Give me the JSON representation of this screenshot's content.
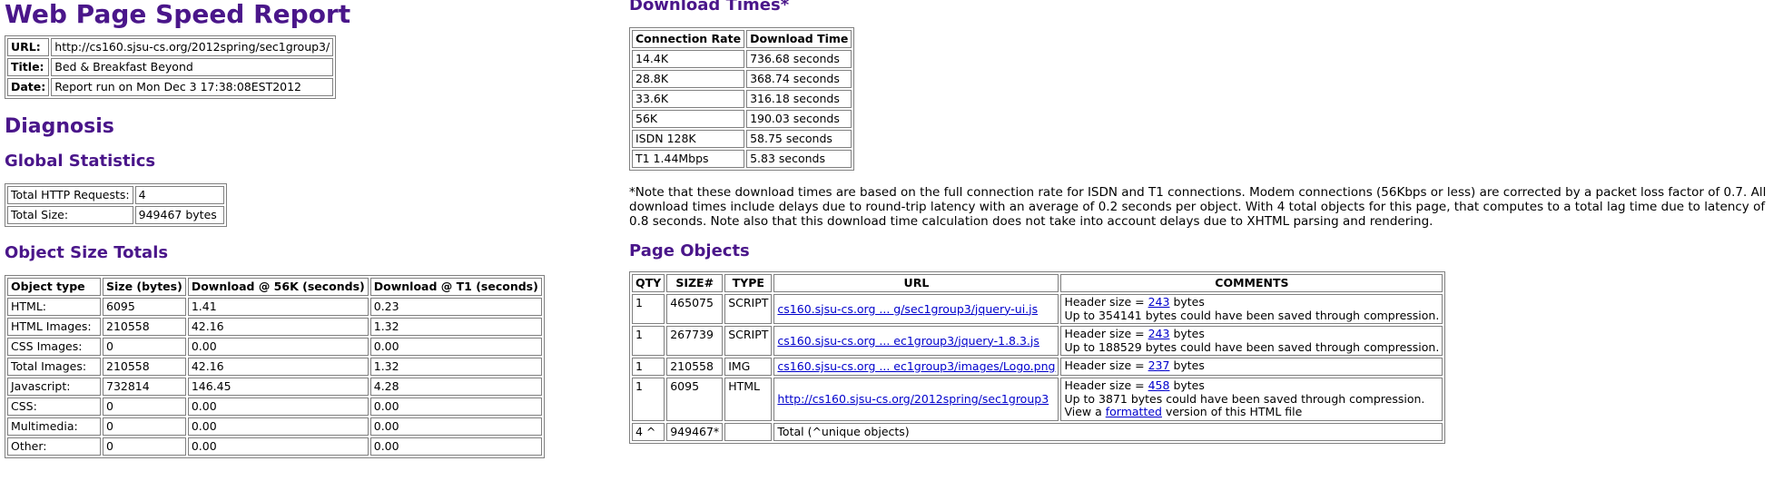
{
  "title": "Web Page Speed Report",
  "info": [
    {
      "label": "URL:",
      "value": "http://cs160.sjsu-cs.org/2012spring/sec1group3/"
    },
    {
      "label": "Title:",
      "value": "Bed & Breakfast Beyond"
    },
    {
      "label": "Date:",
      "value": "Report run on Mon Dec 3 17:38:08EST2012"
    }
  ],
  "diagnosis_heading": "Diagnosis",
  "global": {
    "heading": "Global Statistics",
    "rows": [
      {
        "label": "Total HTTP Requests:",
        "value": "4"
      },
      {
        "label": "Total Size:",
        "value": "949467 bytes"
      }
    ]
  },
  "totals": {
    "heading": "Object Size Totals",
    "headers": [
      "Object type",
      "Size (bytes)",
      "Download @ 56K (seconds)",
      "Download @ T1 (seconds)"
    ],
    "rows": [
      [
        "HTML:",
        "6095",
        "1.41",
        "0.23"
      ],
      [
        "HTML Images:",
        "210558",
        "42.16",
        "1.32"
      ],
      [
        "CSS Images:",
        "0",
        "0.00",
        "0.00"
      ],
      [
        "Total Images:",
        "210558",
        "42.16",
        "1.32"
      ],
      [
        "Javascript:",
        "732814",
        "146.45",
        "4.28"
      ],
      [
        "CSS:",
        "0",
        "0.00",
        "0.00"
      ],
      [
        "Multimedia:",
        "0",
        "0.00",
        "0.00"
      ],
      [
        "Other:",
        "0",
        "0.00",
        "0.00"
      ]
    ]
  },
  "download": {
    "heading": "Download Times*",
    "headers": [
      "Connection Rate",
      "Download Time"
    ],
    "rows": [
      [
        "14.4K",
        "736.68 seconds"
      ],
      [
        "28.8K",
        "368.74 seconds"
      ],
      [
        "33.6K",
        "316.18 seconds"
      ],
      [
        "56K",
        "190.03 seconds"
      ],
      [
        "ISDN 128K",
        "58.75 seconds"
      ],
      [
        "T1 1.44Mbps",
        "5.83 seconds"
      ]
    ],
    "note": "*Note that these download times are based on the full connection rate for ISDN and T1 connections. Modem connections (56Kbps or less) are corrected by a packet loss factor of 0.7. All download times include delays due to round-trip latency with an average of 0.2 seconds per object. With 4 total objects for this page, that computes to a total lag time due to latency of 0.8 seconds. Note also that this download time calculation does not take into account delays due to XHTML parsing and rendering."
  },
  "objects": {
    "heading": "Page Objects",
    "headers": [
      "QTY",
      "SIZE#",
      "TYPE",
      "URL",
      "COMMENTS"
    ],
    "rows": [
      {
        "qty": "1",
        "size": "465075",
        "type": "SCRIPT",
        "url": "cs160.sjsu-cs.org ... g/sec1group3/jquery-ui.js",
        "hdr_pre": "Header size = ",
        "hdr_link": "243",
        "hdr_post": " bytes",
        "extra": "Up to 354141 bytes could have been saved through compression."
      },
      {
        "qty": "1",
        "size": "267739",
        "type": "SCRIPT",
        "url": "cs160.sjsu-cs.org ... ec1group3/jquery-1.8.3.js",
        "hdr_pre": "Header size = ",
        "hdr_link": "243",
        "hdr_post": " bytes",
        "extra": "Up to 188529 bytes could have been saved through compression."
      },
      {
        "qty": "1",
        "size": "210558",
        "type": "IMG",
        "url": "cs160.sjsu-cs.org ... ec1group3/images/Logo.png",
        "hdr_pre": "Header size = ",
        "hdr_link": "237",
        "hdr_post": " bytes"
      },
      {
        "qty": "1",
        "size": "6095",
        "type": "HTML",
        "url": "http://cs160.sjsu-cs.org/2012spring/sec1group3",
        "hdr_pre": "Header size = ",
        "hdr_link": "458",
        "hdr_post": " bytes",
        "extra": "Up to 3871 bytes could have been saved through compression.",
        "view_pre": "View a ",
        "view_link": "formatted",
        "view_post": " version of this HTML file"
      }
    ],
    "total": {
      "qty": "4 ^",
      "size": "949467*",
      "label": "Total (^unique objects)"
    }
  }
}
